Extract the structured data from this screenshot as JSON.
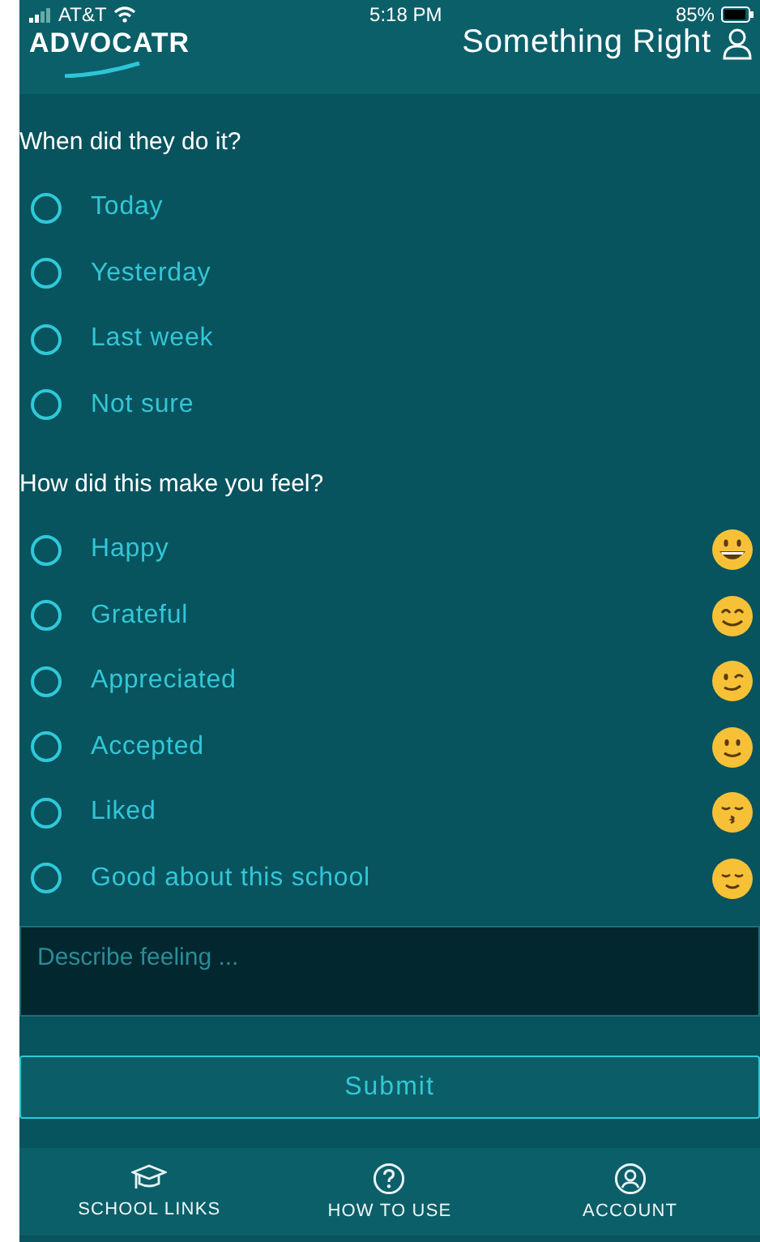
{
  "status_bar": {
    "carrier": "AT&T",
    "time": "5:18 PM",
    "battery": "85%"
  },
  "header": {
    "logo": "ADVOCATR",
    "title": "Something Right"
  },
  "questions": [
    {
      "prompt": "When did they do it?",
      "options": [
        {
          "label": "Today",
          "selected": false
        },
        {
          "label": "Yesterday",
          "selected": false
        },
        {
          "label": "Last week",
          "selected": false
        },
        {
          "label": "Not sure",
          "selected": false
        }
      ]
    },
    {
      "prompt": "How did this make you feel?",
      "options": [
        {
          "label": "Happy",
          "selected": false
        },
        {
          "label": "Grateful",
          "selected": false
        },
        {
          "label": "Appreciated",
          "selected": false
        },
        {
          "label": "Accepted",
          "selected": false
        },
        {
          "label": "Liked",
          "selected": false
        },
        {
          "label": "Good about this school",
          "selected": false
        }
      ]
    }
  ],
  "feeling_field": {
    "placeholder": "Describe feeling ..."
  },
  "submit": "Submit",
  "nav": [
    {
      "label": "SCHOOL LINKS"
    },
    {
      "label": "HOW TO USE"
    },
    {
      "label": "ACCOUNT"
    }
  ]
}
